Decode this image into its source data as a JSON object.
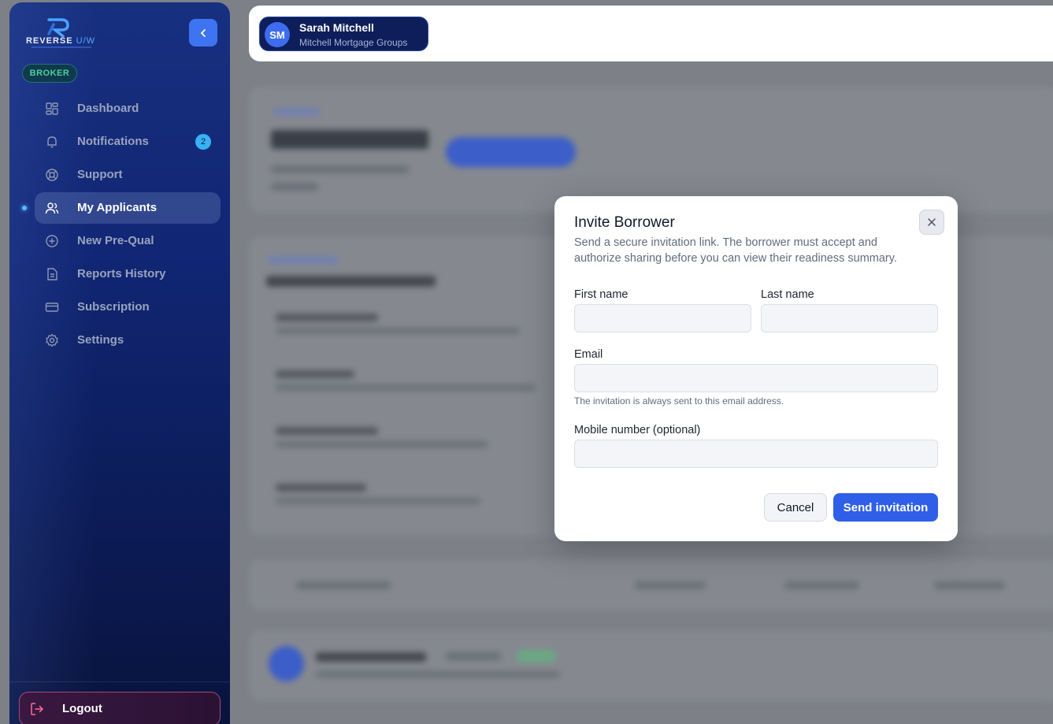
{
  "brand": {
    "logo_text": "REVERSE",
    "logo_text_accent": "U/W"
  },
  "sidebar": {
    "role_badge": "BROKER",
    "items": [
      {
        "label": "Dashboard",
        "icon": "dashboard-icon"
      },
      {
        "label": "Notifications",
        "icon": "bell-icon",
        "badge": "2"
      },
      {
        "label": "Support",
        "icon": "lifebuoy-icon"
      },
      {
        "label": "My Applicants",
        "icon": "users-icon",
        "active": true
      },
      {
        "label": "New Pre-Qual",
        "icon": "plus-circle-icon"
      },
      {
        "label": "Reports History",
        "icon": "document-icon"
      },
      {
        "label": "Subscription",
        "icon": "credit-card-icon"
      },
      {
        "label": "Settings",
        "icon": "gear-icon"
      }
    ],
    "logout_label": "Logout"
  },
  "header": {
    "user": {
      "initials": "SM",
      "name": "Sarah Mitchell",
      "organization": "Mitchell Mortgage Groups"
    }
  },
  "modal": {
    "title": "Invite Borrower",
    "description": "Send a secure invitation link. The borrower must accept and authorize sharing before you can view their readiness summary.",
    "first_name": {
      "label": "First name",
      "value": "",
      "placeholder": ""
    },
    "last_name": {
      "label": "Last name",
      "value": "",
      "placeholder": ""
    },
    "email": {
      "label": "Email",
      "value": "",
      "placeholder": "",
      "hint": "The invitation is always sent to this email address."
    },
    "mobile": {
      "label": "Mobile number (optional)",
      "value": "",
      "placeholder": ""
    },
    "cancel_label": "Cancel",
    "submit_label": "Send invitation"
  },
  "colors": {
    "primary": "#2f5fe8",
    "sidebar": "#112674",
    "accent": "#38b2f4"
  }
}
